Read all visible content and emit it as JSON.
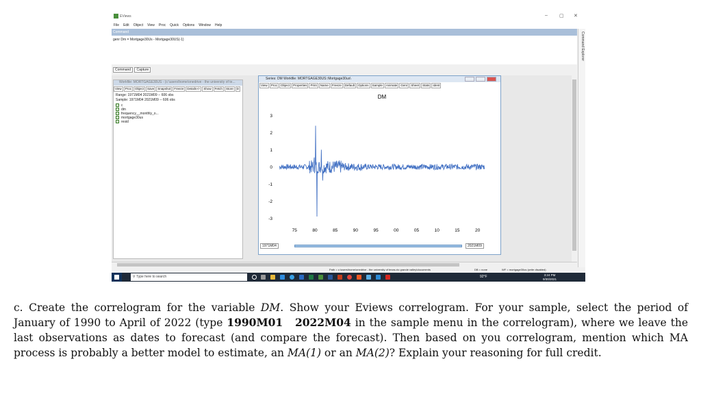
{
  "app": {
    "title": "EViews",
    "icon": "eviews-logo-icon"
  },
  "menu": [
    "File",
    "Edit",
    "Object",
    "View",
    "Proc",
    "Quick",
    "Options",
    "Window",
    "Help"
  ],
  "command": {
    "header": "Command",
    "text": "genr Dm = Mortgage30Us - Mortgage30US(-1)",
    "explorer_label": "Command Explorer",
    "tabs": [
      "Command",
      "Capture"
    ]
  },
  "workfile": {
    "title": "Workfile: MORTGAGE30US - (c:\\users\\home\\onedrive - the university of te...",
    "toolbar": [
      "View",
      "Proc",
      "Object",
      "Save",
      "Snapshot",
      "Freeze",
      "Details+/-",
      "Show",
      "Fetch",
      "Store",
      "D"
    ],
    "range": "Range:  1971M04 2021M09  --  606 obs",
    "sample": "Sample: 1971M04 2021M09  --  606 obs",
    "objects": [
      "c",
      "dm",
      "frequency__monthly_o...",
      "mortgage30us",
      "resid"
    ]
  },
  "series_window": {
    "title": "Series: DM   Workfile: MORTGAGE30US::Mortgage30us\\",
    "toolbar": [
      "View",
      "Proc",
      "Object",
      "Properties",
      "Print",
      "Name",
      "Freeze",
      "Default",
      "Options",
      "Sample",
      "Animate",
      "Genr",
      "Sheet",
      "Stats",
      "Ident"
    ],
    "start_date": "1971M04",
    "end_date": "2021M09"
  },
  "chart_data": {
    "type": "line",
    "title": "DM",
    "x_start": 1971.25,
    "x_end": 2021.75,
    "xlim": [
      1971.25,
      2021.75
    ],
    "ylim": [
      -3.3,
      3.3
    ],
    "yticks": [
      3,
      2,
      1,
      0,
      -1,
      -2,
      -3
    ],
    "xtick_labels": [
      "75",
      "80",
      "85",
      "90",
      "95",
      "00",
      "05",
      "10",
      "15",
      "20"
    ],
    "xtick_values": [
      1975,
      1980,
      1985,
      1990,
      1995,
      2000,
      2005,
      2010,
      2015,
      2020
    ],
    "spikes": [
      {
        "x": 1980.2,
        "y": 2.4
      },
      {
        "x": 1980.5,
        "y": -2.9
      },
      {
        "x": 1981.6,
        "y": 1.0
      },
      {
        "x": 1981.9,
        "y": -0.8
      },
      {
        "x": 1979.8,
        "y": 0.55
      }
    ],
    "grid": false,
    "color": "#4472c4"
  },
  "status": {
    "path": "Path = c:\\users\\home\\onedrive - the university of texas-rio grande valley\\documents",
    "db": "DB = none",
    "wf": "WF = mortgage30us (write disabled)"
  },
  "taskbar": {
    "search_placeholder": "Type here to search",
    "temperature": "92°F",
    "time": "3:24 PM",
    "date": "9/30/2021"
  },
  "question": {
    "p1": "c. Create the correlogram for the variable ",
    "var": "DM",
    "p2": ". Show your Eviews correlogram. For your sample, select the period of January of 1990 to April of 2022 (type ",
    "code1": "1990M01",
    "code2": "2022M04",
    "p3": " in the sample menu in the correlogram), where we leave the last observations as dates to forecast (and compare the forecast). Then based on you correlogram, mention which MA process is probably a better model to estimate, an ",
    "ma1": "MA(1)",
    "p4": " or an ",
    "ma2": "MA(2)",
    "p5": "? Explain your reasoning for full credit."
  }
}
